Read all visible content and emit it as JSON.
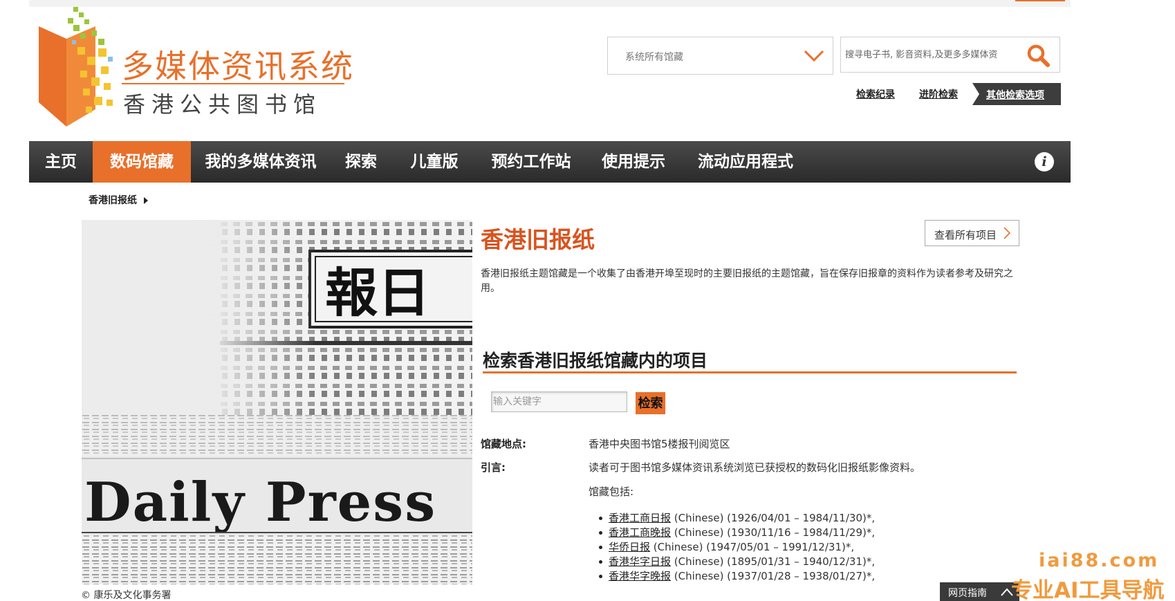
{
  "logo": {
    "title": "多媒体资讯系统",
    "subtitle": "香港公共图书馆"
  },
  "search": {
    "scope_value": "系统所有馆藏",
    "placeholder": "搜寻电子书, 影音资料,及更多多媒体资",
    "links": [
      "检索纪录",
      "进阶检索",
      "其他检索选项"
    ]
  },
  "nav": {
    "items": [
      "主页",
      "数码馆藏",
      "我的多媒体资讯",
      "探索",
      "儿童版",
      "预约工作站",
      "使用提示",
      "流动应用程式"
    ],
    "active_index": 1,
    "info_glyph": "i"
  },
  "breadcrumb": {
    "current": "香港旧报纸"
  },
  "hero": {
    "masthead": "報日",
    "masthead_english": "Daily Press",
    "copyright": "© 康乐及文化事务署"
  },
  "collection": {
    "title": "香港旧报纸",
    "view_all": "查看所有项目",
    "description": "香港旧报纸主题馆藏是一个收集了由香港开埠至现时的主要旧报纸的主题馆藏，旨在保存旧报章的资料作为读者参考及研究之用。",
    "search_title": "检索香港旧报纸馆藏内的项目",
    "keyword_placeholder": "输入关键字",
    "search_button": "检索",
    "location_label": "馆藏地点:",
    "location_value": "香港中央图书馆5楼报刊阅览区",
    "intro_label": "引言:",
    "intro_value": "读者可于图书馆多媒体资讯系统浏览已获授权的数码化旧报纸影像资料。",
    "includes_label": "馆藏包括:",
    "holdings": [
      {
        "name": "香港工商日报",
        "detail": " (Chinese) (1926/04/01 – 1984/11/30)*,"
      },
      {
        "name": "香港工商晚报",
        "detail": " (Chinese) (1930/11/16 – 1984/11/29)*,"
      },
      {
        "name": "华侨日报",
        "detail": " (Chinese) (1947/05/01 – 1991/12/31)*,"
      },
      {
        "name": "香港华字日报",
        "detail": " (Chinese) (1895/01/31 – 1940/12/31)*,"
      },
      {
        "name": "香港华字晚报",
        "detail": " (Chinese) (1937/01/28 – 1938/01/27)*,"
      }
    ]
  },
  "footer": {
    "guide": "网页指南"
  },
  "watermark": {
    "line1": "iai88.com",
    "line2": "专业AI工具导航"
  },
  "colors": {
    "accent": "#e8702a",
    "title": "#d9531e",
    "nav_bg": "#333333"
  }
}
